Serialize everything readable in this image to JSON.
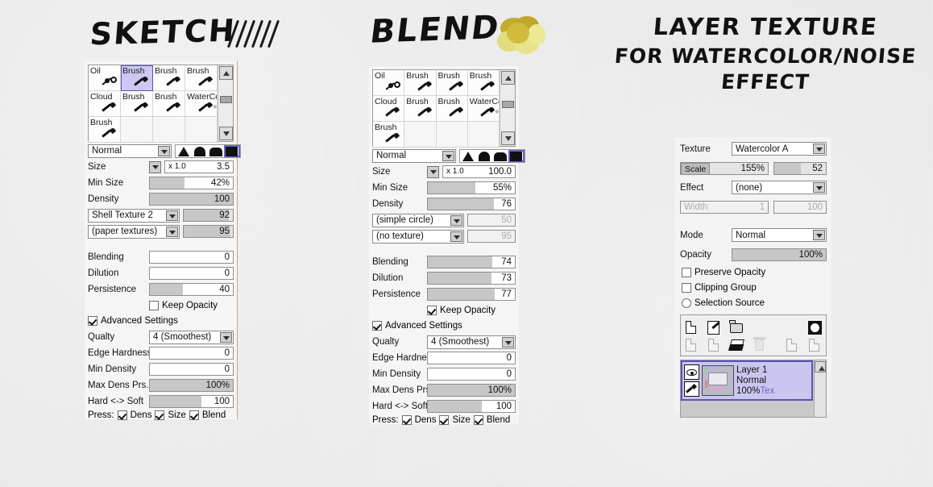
{
  "headings": {
    "sketch": "SKETCH",
    "blend": "BLEND",
    "layer_line1": "LAYER TEXTURE",
    "layer_line2": "FOR WATERCOLOR/NOISE",
    "layer_line3": "EFFECT"
  },
  "brush_grid": {
    "cells": [
      {
        "label": "Oil",
        "icon": "airbrush-icon",
        "selected": false
      },
      {
        "label": "Brush",
        "icon": "brush-icon",
        "selected": true
      },
      {
        "label": "Brush",
        "icon": "brush-icon",
        "selected": false
      },
      {
        "label": "Brush",
        "icon": "brush-icon",
        "selected": false
      },
      {
        "label": "Cloud",
        "icon": "brush-icon",
        "selected": false
      },
      {
        "label": "Brush",
        "icon": "brush-icon",
        "selected": false
      },
      {
        "label": "Brush",
        "icon": "brush-icon",
        "selected": false
      },
      {
        "label": "WaterCo",
        "icon": "watercolor-icon",
        "selected": false
      },
      {
        "label": "Brush",
        "icon": "brush-icon",
        "selected": false
      },
      {
        "label": "",
        "icon": "",
        "selected": false
      },
      {
        "label": "",
        "icon": "",
        "selected": false
      },
      {
        "label": "",
        "icon": "",
        "selected": false
      }
    ]
  },
  "sketch": {
    "blend_mode": "Normal",
    "shape_selected_index": 3,
    "size": {
      "label": "Size",
      "multiplier": "x 1.0",
      "value": "3.5"
    },
    "min_size": {
      "label": "Min Size",
      "value": "42%",
      "fill_pct": 42
    },
    "density": {
      "label": "Density",
      "value": "100",
      "fill_pct": 100
    },
    "texture_shape": {
      "name": "Shell Texture 2",
      "value": "92",
      "fill_pct": 92
    },
    "texture_paper": {
      "name": "(paper textures)",
      "value": "95",
      "fill_pct": 95
    },
    "blending": {
      "label": "Blending",
      "value": "0",
      "fill_pct": 0
    },
    "dilution": {
      "label": "Dilution",
      "value": "0",
      "fill_pct": 0
    },
    "persistence": {
      "label": "Persistence",
      "value": "40",
      "fill_pct": 40
    },
    "keep_opacity": {
      "label": "Keep Opacity",
      "checked": false
    },
    "advanced_settings": {
      "label": "Advanced Settings",
      "checked": true
    },
    "quality": {
      "label": "Qualty",
      "value": "4 (Smoothest)"
    },
    "edge_hardness": {
      "label": "Edge Hardness",
      "value": "0",
      "fill_pct": 0
    },
    "min_density": {
      "label": "Min Density",
      "value": "0",
      "fill_pct": 0
    },
    "max_dens_prs": {
      "label": "Max Dens Prs.",
      "value": "100%",
      "fill_pct": 100
    },
    "hard_soft": {
      "label": "Hard <-> Soft",
      "value": "100",
      "fill_pct": 62
    },
    "press": {
      "label": "Press:",
      "dens": {
        "label": "Dens",
        "checked": true
      },
      "size": {
        "label": "Size",
        "checked": true
      },
      "blend": {
        "label": "Blend",
        "checked": true
      }
    }
  },
  "blend": {
    "blend_mode": "Normal",
    "shape_selected_index": 3,
    "size": {
      "label": "Size",
      "multiplier": "x 1.0",
      "value": "100.0"
    },
    "min_size": {
      "label": "Min Size",
      "value": "55%",
      "fill_pct": 55
    },
    "density": {
      "label": "Density",
      "value": "76",
      "fill_pct": 76
    },
    "texture_shape": {
      "name": "(simple circle)",
      "value": "50",
      "fill_pct": 0
    },
    "texture_paper": {
      "name": "(no texture)",
      "value": "95",
      "fill_pct": 0
    },
    "blending": {
      "label": "Blending",
      "value": "74",
      "fill_pct": 74
    },
    "dilution": {
      "label": "Dilution",
      "value": "73",
      "fill_pct": 73
    },
    "persistence": {
      "label": "Persistence",
      "value": "77",
      "fill_pct": 77
    },
    "keep_opacity": {
      "label": "Keep Opacity",
      "checked": true
    },
    "advanced_settings": {
      "label": "Advanced Settings",
      "checked": true
    },
    "quality": {
      "label": "Qualty",
      "value": "4 (Smoothest)"
    },
    "edge_hardness": {
      "label": "Edge Hardness",
      "value": "0",
      "fill_pct": 0
    },
    "min_density": {
      "label": "Min Density",
      "value": "0",
      "fill_pct": 0
    },
    "max_dens_prs": {
      "label": "Max Dens Prs.",
      "value": "100%",
      "fill_pct": 100
    },
    "hard_soft": {
      "label": "Hard <-> Soft",
      "value": "100",
      "fill_pct": 62
    },
    "press": {
      "label": "Press:",
      "dens": {
        "label": "Dens",
        "checked": true
      },
      "size": {
        "label": "Size",
        "checked": true
      },
      "blend": {
        "label": "Blend",
        "checked": true
      }
    }
  },
  "layer_panel": {
    "texture": {
      "label": "Texture",
      "value": "Watercolor A"
    },
    "scale": {
      "label": "Scale",
      "value": "155%",
      "strength": "52",
      "strength_fill_pct": 52
    },
    "effect": {
      "label": "Effect",
      "value": "(none)"
    },
    "width": {
      "label": "Width",
      "value": "1",
      "strength": "100"
    },
    "mode": {
      "label": "Mode",
      "value": "Normal"
    },
    "opacity": {
      "label": "Opacity",
      "value": "100%",
      "fill_pct": 100
    },
    "preserve_opacity": {
      "label": "Preserve Opacity",
      "checked": false
    },
    "clipping_group": {
      "label": "Clipping Group",
      "checked": false
    },
    "selection_source": {
      "label": "Selection Source",
      "checked": false
    },
    "toolbar_row1": [
      "new-layer-icon",
      "new-linework-layer-icon",
      "new-folder-icon",
      "layer-mask-icon"
    ],
    "toolbar_row2": [
      "merge-down-icon",
      "merge-selected-icon",
      "clear-layer-icon",
      "delete-layer-icon",
      "transfer-down-icon",
      "add-below-icon"
    ],
    "layer": {
      "name": "Layer 1",
      "mode": "Normal",
      "opacity": "100%",
      "texture_flag": "Tex"
    }
  },
  "colors": {
    "selection_purple": "#cbc6ef",
    "selection_border": "#5b53b8",
    "panel_bg": "#f5f5f5",
    "slider_fill": "#c7c7c7",
    "blob_yellow": "#c9b02e",
    "accent_link": "#6a62c8"
  }
}
